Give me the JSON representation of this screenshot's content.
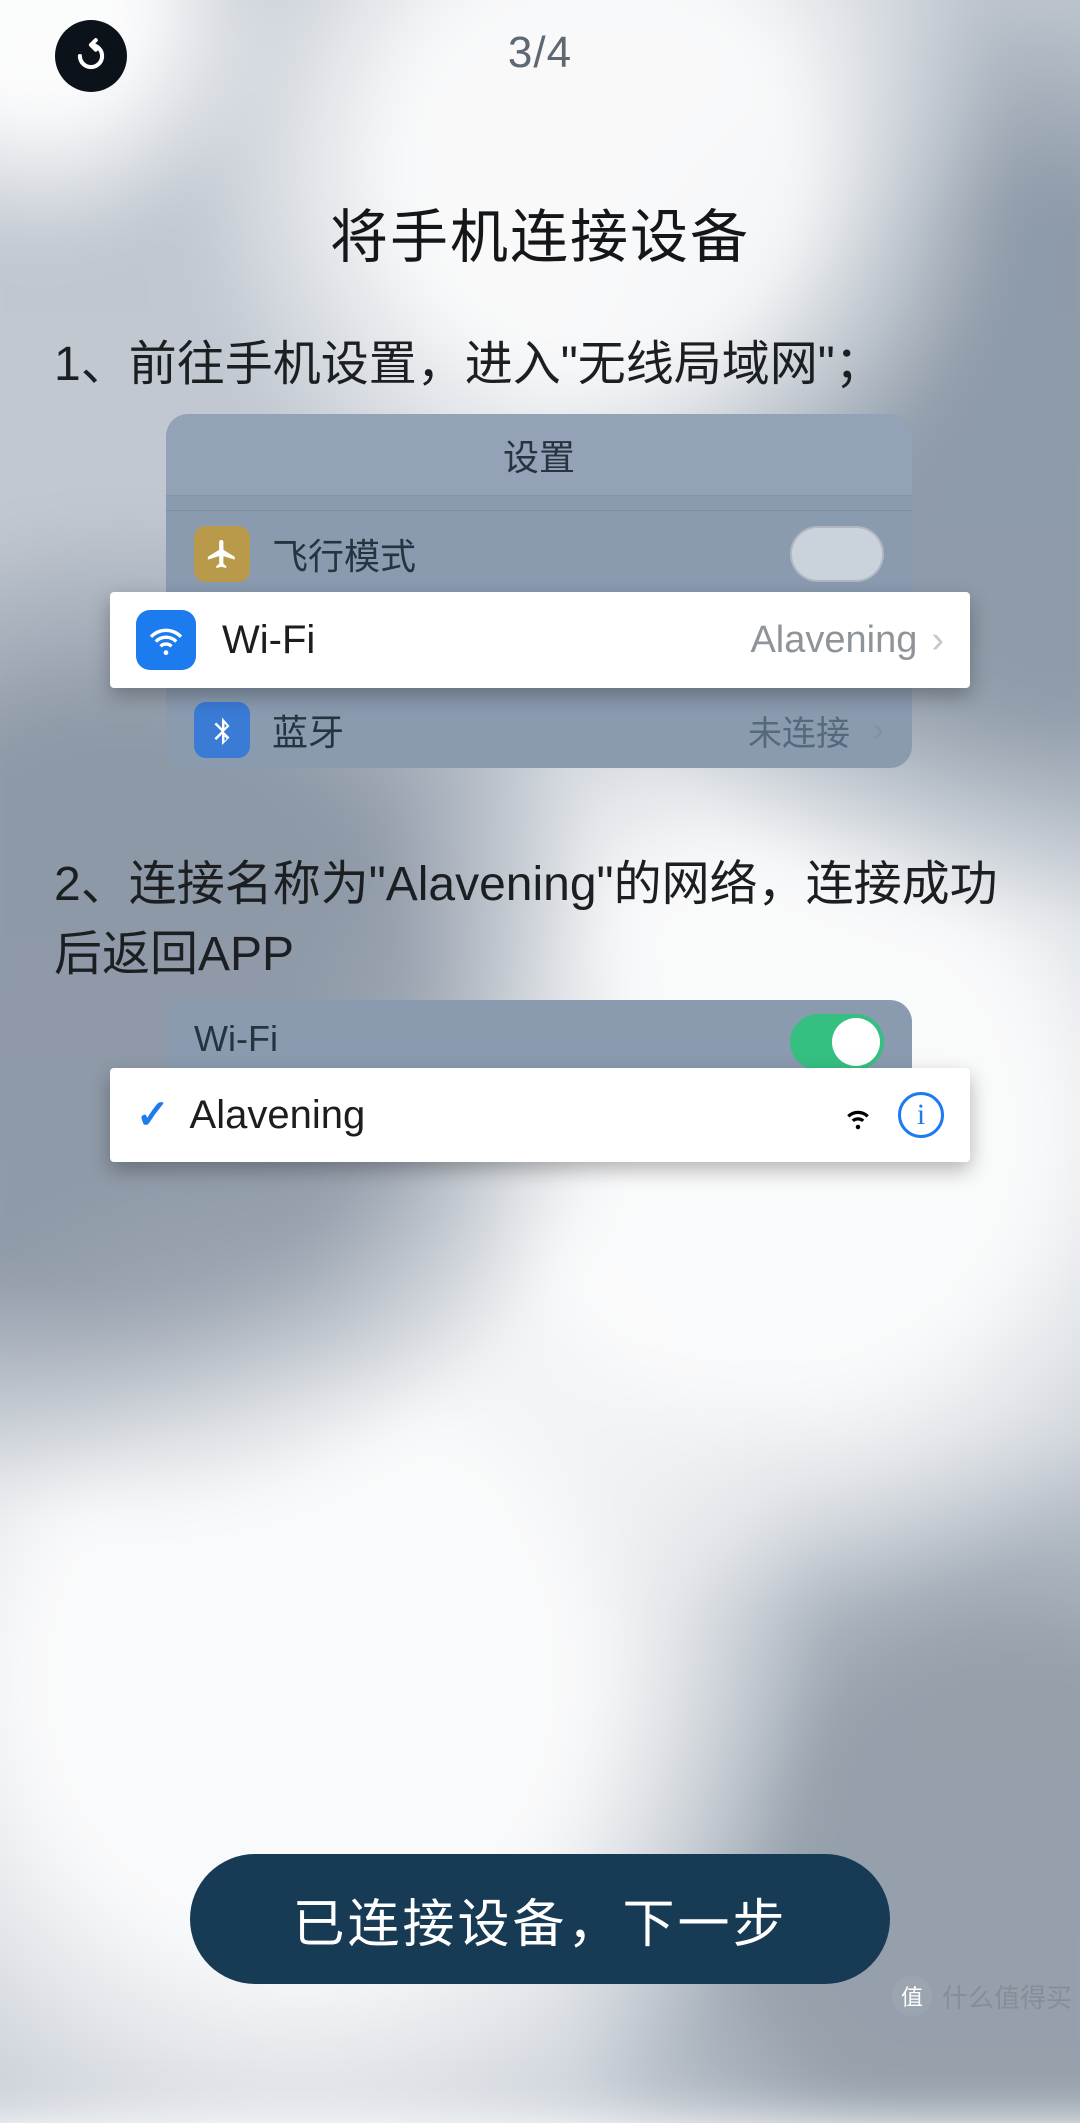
{
  "header": {
    "page_indicator": "3/4"
  },
  "title": "将手机连接设备",
  "steps": {
    "s1": "1、前往手机设置，进入\"无线局域网\"；",
    "s2": "2、连接名称为\"Alavening\"的网络，连接成功后返回APP"
  },
  "settings_panel": {
    "title": "设置",
    "airplane_label": "飞行模式",
    "wifi_label": "Wi-Fi",
    "wifi_value": "Alavening",
    "bt_label": "蓝牙",
    "bt_value": "未连接"
  },
  "wifi_panel": {
    "toggle_label": "Wi-Fi",
    "network": "Alavening"
  },
  "button": {
    "next": "已连接设备，下一步"
  },
  "watermark": {
    "text": "什么值得买",
    "badge": "值"
  }
}
